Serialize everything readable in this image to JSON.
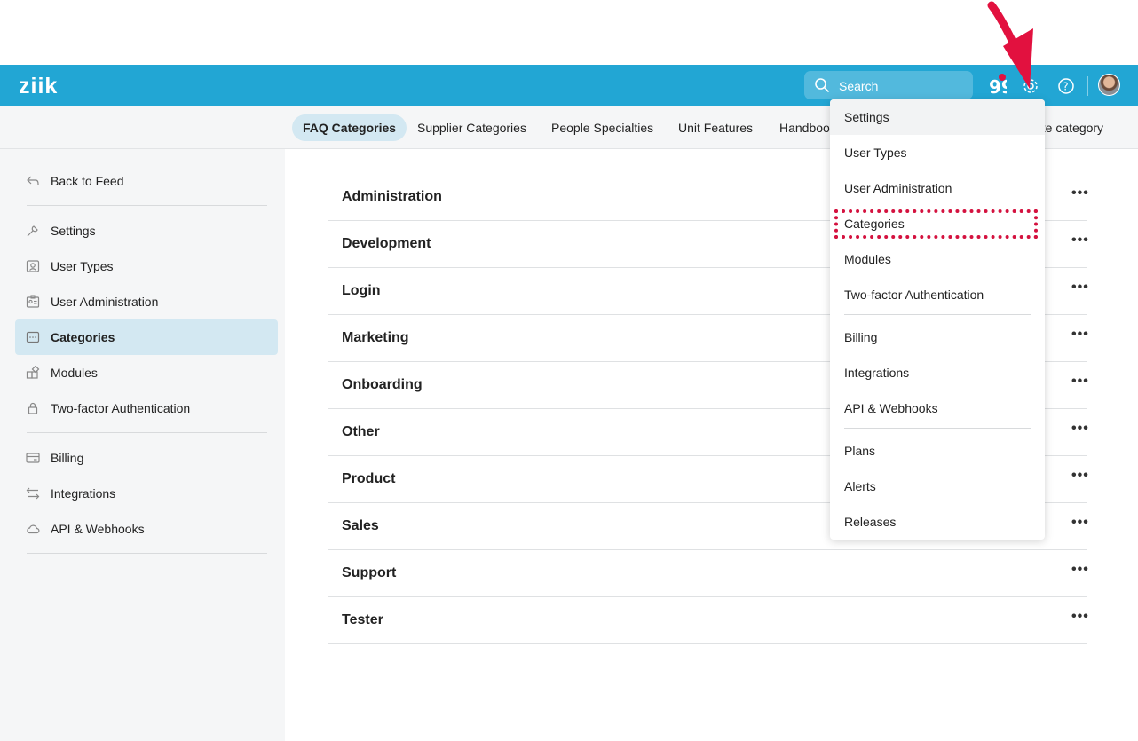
{
  "app": {
    "logo": "ziik"
  },
  "topbar": {
    "search_placeholder": "Search",
    "icons": [
      "search-icon",
      "quote-icon",
      "gear-icon",
      "help-icon",
      "avatar"
    ]
  },
  "tabs": [
    {
      "label": "FAQ Categories",
      "active": true
    },
    {
      "label": "Supplier Categories",
      "active": false
    },
    {
      "label": "People Specialties",
      "active": false
    },
    {
      "label": "Unit Features",
      "active": false
    },
    {
      "label": "Handbook",
      "active": false
    },
    {
      "label": "ate category",
      "active": false
    }
  ],
  "sidebar": {
    "back": "Back to Feed",
    "items": [
      {
        "label": "Settings",
        "icon": "wrench-icon"
      },
      {
        "label": "User Types",
        "icon": "id-card-icon"
      },
      {
        "label": "User Administration",
        "icon": "user-card-icon"
      },
      {
        "label": "Categories",
        "icon": "category-icon",
        "active": true
      },
      {
        "label": "Modules",
        "icon": "modules-icon"
      },
      {
        "label": "Two-factor Authentication",
        "icon": "lock-icon"
      },
      {
        "label": "Billing",
        "icon": "credit-card-icon"
      },
      {
        "label": "Integrations",
        "icon": "arrows-icon"
      },
      {
        "label": "API & Webhooks",
        "icon": "cloud-icon"
      }
    ]
  },
  "categories": [
    "Administration",
    "Development",
    "Login",
    "Marketing",
    "Onboarding",
    "Other",
    "Product",
    "Sales",
    "Support",
    "Tester"
  ],
  "row_more": "•••",
  "dropdown": {
    "items": [
      "Settings",
      "User Types",
      "User Administration",
      "Categories",
      "Modules",
      "Two-factor Authentication",
      "Billing",
      "Integrations",
      "API & Webhooks",
      "Plans",
      "Alerts",
      "Releases"
    ]
  },
  "colors": {
    "topbar": "#22a6d4",
    "active_bg": "#d3e8f2",
    "annotation": "#d4123f"
  }
}
